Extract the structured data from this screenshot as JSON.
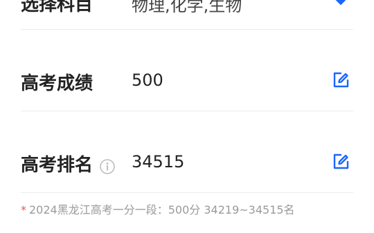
{
  "rows": [
    {
      "label": "选择科目",
      "value": "物理,化学,生物"
    },
    {
      "label": "高考成绩",
      "value": "500"
    },
    {
      "label": "高考排名",
      "value": "34515"
    }
  ],
  "footnote": {
    "marker": "*",
    "text": "2024黑龙江高考一分一段：500分 34219~34515名"
  },
  "colors": {
    "accent": "#1a66ff",
    "note": "#9a9a9a",
    "marker": "#e8554e"
  },
  "icons": {
    "edit": "edit-icon",
    "info": "info-icon",
    "dropdown": "chevron-down-icon"
  }
}
